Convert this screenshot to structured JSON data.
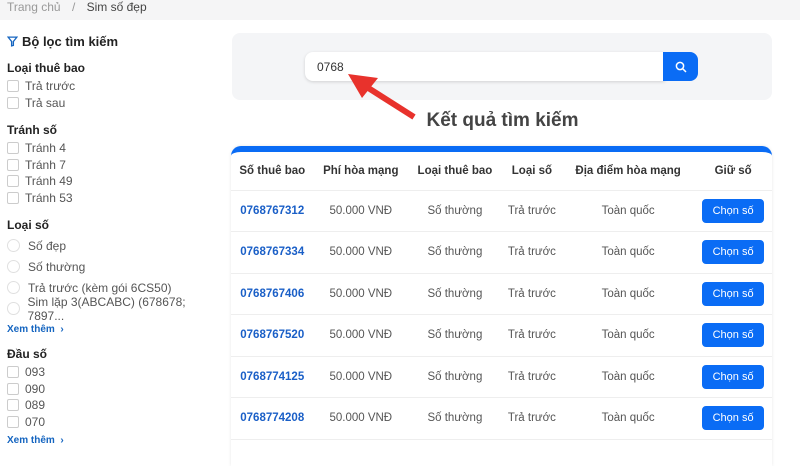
{
  "breadcrumb": {
    "home": "Trang chủ",
    "sep": "/",
    "current": "Sim số đẹp"
  },
  "filter": {
    "title": "Bộ lọc tìm kiếm",
    "subscription": {
      "label": "Loại thuê bao",
      "options": [
        "Trả trước",
        "Trả sau"
      ]
    },
    "avoid": {
      "label": "Tránh số",
      "options": [
        "Tránh 4",
        "Tránh 7",
        "Tránh 49",
        "Tránh 53"
      ]
    },
    "number_type": {
      "label": "Loại số",
      "options": [
        "Số đẹp",
        "Số thường",
        "Trả trước (kèm gói 6CS50)",
        "Sim lặp 3(ABCABC) (678678; 7897..."
      ],
      "more": "Xem thêm"
    },
    "prefix": {
      "label": "Đầu số",
      "options": [
        "093",
        "090",
        "089",
        "070"
      ],
      "more": "Xem thêm"
    }
  },
  "search": {
    "value": "0768"
  },
  "results_title": "Kết quả tìm kiếm",
  "table": {
    "headers": [
      "Số thuê bao",
      "Phí hòa mạng",
      "Loại thuê bao",
      "Loại số",
      "Địa điểm hòa mạng",
      "Giữ số"
    ],
    "rows": [
      [
        "0768767312",
        "50.000 VNĐ",
        "Số thường",
        "Trả trước",
        "Toàn quốc",
        "Chọn số"
      ],
      [
        "0768767334",
        "50.000 VNĐ",
        "Số thường",
        "Trả trước",
        "Toàn quốc",
        "Chọn số"
      ],
      [
        "0768767406",
        "50.000 VNĐ",
        "Số thường",
        "Trả trước",
        "Toàn quốc",
        "Chọn số"
      ],
      [
        "0768767520",
        "50.000 VNĐ",
        "Số thường",
        "Trả trước",
        "Toàn quốc",
        "Chọn số"
      ],
      [
        "0768774125",
        "50.000 VNĐ",
        "Số thường",
        "Trả trước",
        "Toàn quốc",
        "Chọn số"
      ],
      [
        "0768774208",
        "50.000 VNĐ",
        "Số thường",
        "Trả trước",
        "Toàn quốc",
        "Chọn số"
      ]
    ]
  },
  "colors": {
    "accent": "#0a6cf5",
    "link": "#1a5fc7",
    "arrow": "#e8322c"
  }
}
